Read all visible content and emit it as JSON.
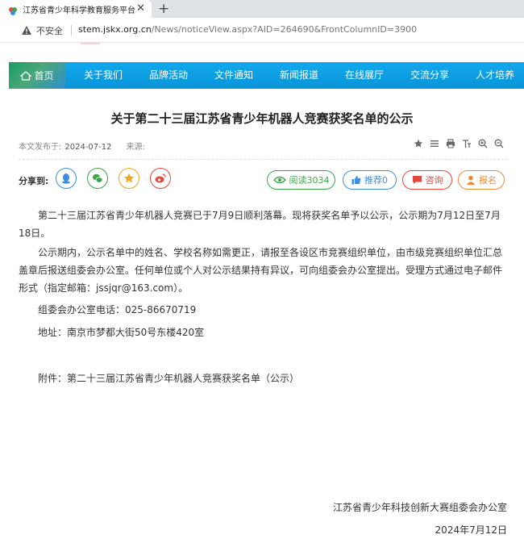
{
  "browser": {
    "tab_title": "江苏省青少年科学教育服务平台",
    "close_glyph": "✕",
    "new_tab_glyph": "+",
    "security_label": "不安全",
    "url_host": "stem.jskx.org.cn",
    "url_path": "/News/noticeView.aspx?AID=264690&FrontColumnID=3900"
  },
  "nav": {
    "items": [
      "首页",
      "关于我们",
      "品牌活动",
      "文件通知",
      "新闻报道",
      "在线展厅",
      "交流分享",
      "人才培养"
    ]
  },
  "article": {
    "title": "关于第二十三届江苏省青少年机器人竞赛获奖名单的公示",
    "published_label": "本文发布于:",
    "published_date": "2024-07-12",
    "source_label": "来源:",
    "share_label": "分享到:",
    "reads_label": "阅读3034",
    "recommend_label": "推荐0",
    "consult_label": "咨询",
    "signup_label": "报名",
    "paragraphs": [
      "第二十三届江苏省青少年机器人竞赛已于7月9日顺利落幕。现将获奖名单予以公示，公示期为7月12日至7月18日。",
      "公示期内，公示名单中的姓名、学校名称如需更正，请报至各设区市竞赛组织单位，由市级竞赛组织单位汇总盖章后报送组委会办公室。任何单位或个人对公示结果持有异议，可向组委会办公室提出。受理方式通过电子邮件形式（指定邮箱：jssjqr@163.com）。",
      "组委会办公室电话：025-86670719",
      "地址：南京市梦都大街50号东楼420室",
      "附件：第二十三届江苏省青少年机器人竞赛获奖名单（公示）"
    ],
    "signature_org": "江苏省青少年科技创新大赛组委会办公室",
    "signature_date": "2024年7月12日"
  },
  "colors": {
    "nav_blue": "#0a9ee2",
    "qq": "#3b8fe0",
    "wechat": "#3aa548",
    "qzone": "#f2a521",
    "weibo": "#e5483b",
    "reads": "#3aa548",
    "recommend": "#3b8fe0",
    "consult": "#e5483b",
    "signup": "#f08a34"
  }
}
